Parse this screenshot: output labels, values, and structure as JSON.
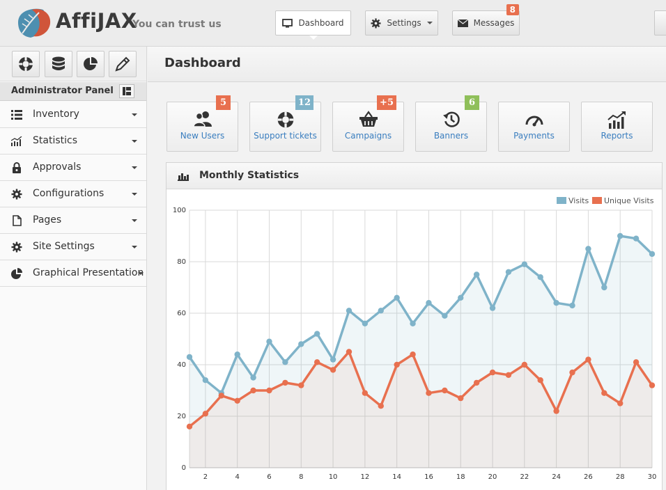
{
  "header": {
    "brand": "AffiJAX",
    "tagline": "You can trust us",
    "nav": {
      "dashboard": "Dashboard",
      "settings": "Settings",
      "messages": "Messages",
      "messages_badge": "8"
    }
  },
  "sidebar": {
    "panel_title": "Administrator Panel",
    "items": [
      {
        "label": "Inventory",
        "icon": "list-icon"
      },
      {
        "label": "Statistics",
        "icon": "bar-chart-icon"
      },
      {
        "label": "Approvals",
        "icon": "lock-icon"
      },
      {
        "label": "Configurations",
        "icon": "gear-icon"
      },
      {
        "label": "Pages",
        "icon": "page-icon"
      },
      {
        "label": "Site Settings",
        "icon": "gear-icon"
      },
      {
        "label": "Graphical Presentation",
        "icon": "pie-chart-icon"
      }
    ]
  },
  "main": {
    "page_title": "Dashboard",
    "tiles": [
      {
        "label": "New Users",
        "badge": "5",
        "badge_color": "#e8704f",
        "icon": "users-icon"
      },
      {
        "label": "Support tickets",
        "badge": "12",
        "badge_color": "#7fb3c9",
        "icon": "lifebuoy-icon"
      },
      {
        "label": "Campaigns",
        "badge": "+5",
        "badge_color": "#e8704f",
        "icon": "basket-icon"
      },
      {
        "label": "Banners",
        "badge": "6",
        "badge_color": "#8fbf5a",
        "icon": "history-icon"
      },
      {
        "label": "Payments",
        "badge": "",
        "badge_color": "",
        "icon": "gauge-icon"
      },
      {
        "label": "Reports",
        "badge": "",
        "badge_color": "",
        "icon": "growth-chart-icon"
      }
    ],
    "stats_title": "Monthly Statistics"
  },
  "chart_data": {
    "type": "area",
    "title": "",
    "xlabel": "",
    "ylabel": "",
    "x": [
      1,
      2,
      3,
      4,
      5,
      6,
      7,
      8,
      9,
      10,
      11,
      12,
      13,
      14,
      15,
      16,
      17,
      18,
      19,
      20,
      21,
      22,
      23,
      24,
      25,
      26,
      27,
      28,
      29,
      30
    ],
    "x_ticks": [
      2,
      4,
      6,
      8,
      10,
      12,
      14,
      16,
      18,
      20,
      22,
      24,
      26,
      28,
      30
    ],
    "y_ticks": [
      0,
      20,
      40,
      60,
      80,
      100
    ],
    "ylim": [
      0,
      100
    ],
    "grid": true,
    "legend_position": "top-right",
    "series": [
      {
        "name": "Visits",
        "color": "#7fb3c9",
        "values": [
          43,
          34,
          29,
          44,
          35,
          49,
          41,
          48,
          52,
          42,
          61,
          56,
          61,
          66,
          56,
          64,
          59,
          66,
          75,
          62,
          76,
          79,
          74,
          64,
          63,
          85,
          70,
          90,
          89,
          83
        ]
      },
      {
        "name": "Unique Visits",
        "color": "#e8704f",
        "values": [
          16,
          21,
          28,
          26,
          30,
          30,
          33,
          32,
          41,
          38,
          45,
          29,
          24,
          40,
          44,
          29,
          30,
          27,
          33,
          37,
          36,
          40,
          34,
          22,
          37,
          42,
          29,
          25,
          41,
          32
        ]
      }
    ]
  }
}
